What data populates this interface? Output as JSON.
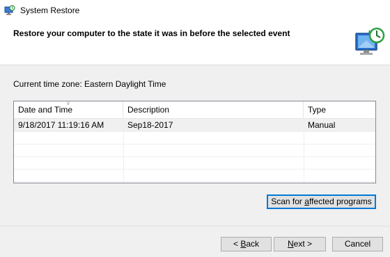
{
  "window": {
    "title": "System Restore"
  },
  "header": {
    "title": "Restore your computer to the state it was in before the selected event"
  },
  "timezone": {
    "label": "Current time zone: ",
    "value": "Eastern Daylight Time"
  },
  "table": {
    "columns": [
      {
        "label": "Date and Time"
      },
      {
        "label": "Description"
      },
      {
        "label": "Type"
      }
    ],
    "rows": [
      {
        "date": "9/18/2017 11:19:16 AM",
        "description": "Sep18-2017",
        "type": "Manual",
        "selected": true
      }
    ]
  },
  "buttons": {
    "scan": {
      "before": "Scan for ",
      "mnemonic": "a",
      "after": "ffected programs"
    },
    "back": {
      "before": "< ",
      "mnemonic": "B",
      "after": "ack"
    },
    "next": {
      "before": "",
      "mnemonic": "N",
      "after": "ext >"
    },
    "cancel": {
      "label": "Cancel"
    }
  },
  "colors": {
    "selection_row": "#f0f0f0",
    "focus_border": "#0078d7",
    "dialog_background": "#f0f0f0",
    "header_background": "#ffffff"
  },
  "icons": {
    "title": "system-restore-icon",
    "header": "monitor-restore-clock-icon",
    "sort": "sort-descending-icon"
  }
}
